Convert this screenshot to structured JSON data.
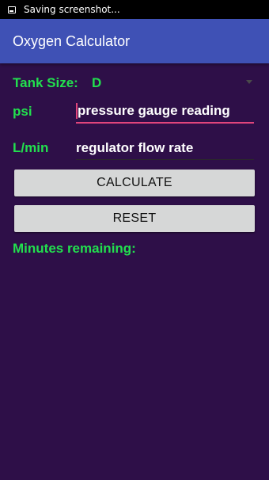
{
  "status_bar": {
    "notification_icon": "screenshot-icon",
    "text": "Saving screenshot..."
  },
  "app_bar": {
    "title": "Oxygen Calculator"
  },
  "form": {
    "tank_size_label": "Tank Size:",
    "tank_size_value": "D",
    "psi_label": "psi",
    "psi_placeholder": "pressure gauge reading",
    "lmin_label": "L/min",
    "lmin_placeholder": "regulator flow rate"
  },
  "buttons": {
    "calculate_label": "CALCULATE",
    "reset_label": "RESET"
  },
  "result": {
    "minutes_remaining_label": "Minutes remaining:"
  },
  "colors": {
    "background": "#2e0f48",
    "app_bar": "#3f51b5",
    "label_green": "#22e04e",
    "focus_accent": "#e0457b",
    "button": "#d6d7d7"
  }
}
